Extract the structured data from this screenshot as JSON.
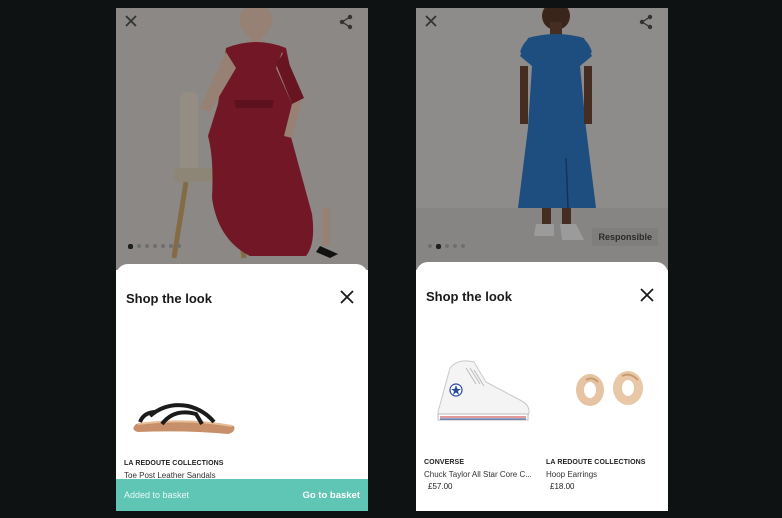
{
  "left_screen": {
    "sheet": {
      "title": "Shop the look",
      "products": [
        {
          "brand": "LA REDOUTE COLLECTIONS",
          "name": "Toe Post Leather Sandals",
          "price": ""
        }
      ]
    },
    "basket_bar": {
      "status": "Added to basket",
      "action": "Go to basket"
    },
    "icons": {
      "close": "close-icon",
      "share": "share-icon",
      "sheet_close": "close-icon"
    }
  },
  "right_screen": {
    "badge": "Responsible",
    "sheet": {
      "title": "Shop the look",
      "products": [
        {
          "brand": "CONVERSE",
          "name": "Chuck Taylor All Star Core C...",
          "price": "£57.00"
        },
        {
          "brand": "LA REDOUTE COLLECTIONS",
          "name": "Hoop Earrings",
          "price": "£18.00"
        }
      ]
    },
    "icons": {
      "close": "close-icon",
      "share": "share-icon",
      "sheet_close": "close-icon"
    }
  },
  "colors": {
    "background": "#0e1213",
    "basket_bar": "#5fc5b4",
    "dress_red": "#b0243a",
    "dress_blue": "#2f78c4"
  }
}
